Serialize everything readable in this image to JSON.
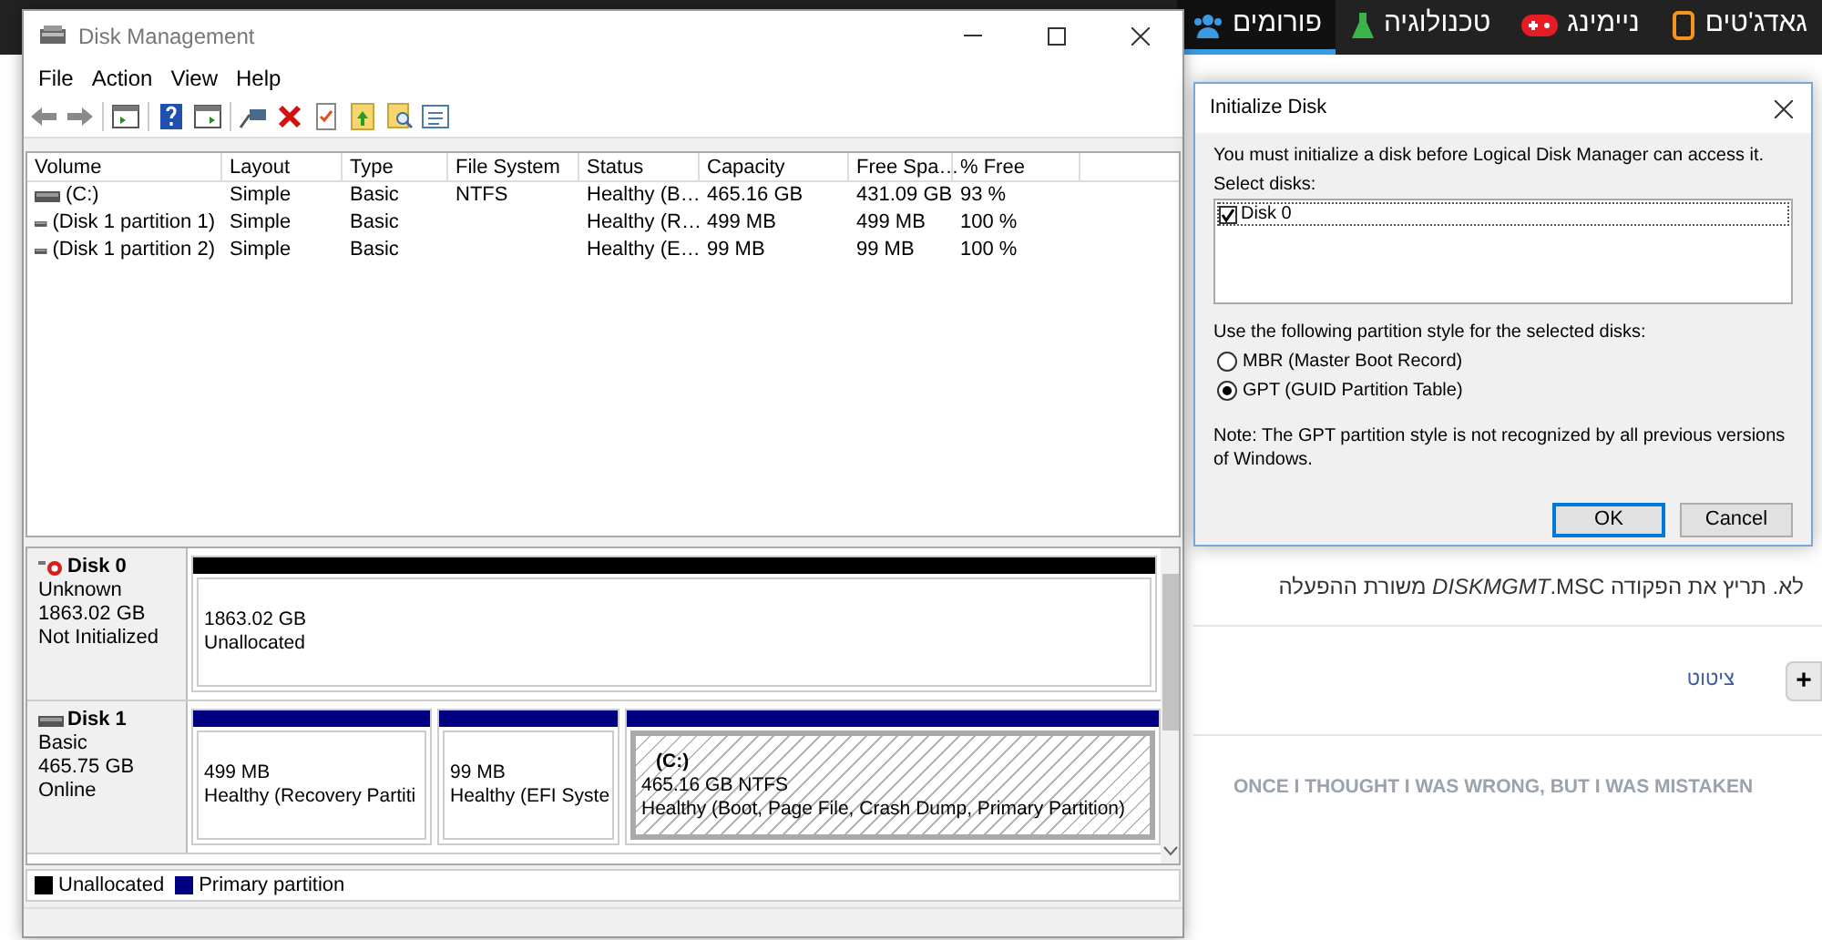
{
  "site_nav": {
    "tabs": [
      {
        "label": "גאדג'טים",
        "selected": false
      },
      {
        "label": "ניימינג",
        "selected": false
      },
      {
        "label": "טכנולוגיה",
        "selected": false
      },
      {
        "label": "פורומים",
        "selected": true
      }
    ]
  },
  "post": {
    "text": "לא.  תריץ את הפקודה *DISKMGMT*.MSC משורת ההפעלה",
    "quote_link": "ציטוט",
    "add_button": "+",
    "signature": "ONCE I THOUGHT I WAS WRONG, BUT I WAS MISTAKEN"
  },
  "disk_management": {
    "title": "Disk Management",
    "menu": [
      "File",
      "Action",
      "View",
      "Help"
    ],
    "columns": [
      "Volume",
      "Layout",
      "Type",
      "File System",
      "Status",
      "Capacity",
      "Free Spa…",
      "% Free"
    ],
    "rows": [
      {
        "volume": "(C:)",
        "layout": "Simple",
        "type": "Basic",
        "file_system": "NTFS",
        "status": "Healthy (B…",
        "capacity": "465.16 GB",
        "free_space": "431.09 GB",
        "percent_free": "93 %"
      },
      {
        "volume": "(Disk 1 partition 1)",
        "layout": "Simple",
        "type": "Basic",
        "file_system": "",
        "status": "Healthy (R…",
        "capacity": "499 MB",
        "free_space": "499 MB",
        "percent_free": "100 %"
      },
      {
        "volume": "(Disk 1 partition 2)",
        "layout": "Simple",
        "type": "Basic",
        "file_system": "",
        "status": "Healthy (E…",
        "capacity": "99 MB",
        "free_space": "99 MB",
        "percent_free": "100 %"
      }
    ],
    "disks": [
      {
        "name": "Disk 0",
        "kind": "error",
        "info": [
          "Unknown",
          "1863.02 GB",
          "Not Initialized"
        ],
        "partitions": [
          {
            "kind": "unallocated",
            "selected": false,
            "lines": [
              "1863.02 GB",
              "Unallocated"
            ]
          }
        ]
      },
      {
        "name": "Disk 1",
        "kind": "online",
        "info": [
          "Basic",
          "465.75 GB",
          "Online"
        ],
        "partitions": [
          {
            "kind": "primary",
            "selected": false,
            "lines": [
              "499 MB",
              "Healthy (Recovery Partiti"
            ]
          },
          {
            "kind": "primary",
            "selected": false,
            "lines": [
              "99 MB",
              "Healthy (EFI Syste"
            ]
          },
          {
            "kind": "primary",
            "selected": true,
            "label": "(C:)",
            "lines": [
              "465.16 GB NTFS",
              "Healthy (Boot, Page File, Crash Dump, Primary Partition)"
            ]
          }
        ]
      }
    ],
    "legend": [
      {
        "label": "Unallocated",
        "color": "#000000"
      },
      {
        "label": "Primary partition",
        "color": "#000080"
      }
    ]
  },
  "dialog": {
    "title": "Initialize Disk",
    "message": "You must initialize a disk before Logical Disk Manager can access it.",
    "select_label": "Select disks:",
    "disks": [
      {
        "label": "Disk 0",
        "checked": true
      }
    ],
    "style_label": "Use the following partition style for the selected disks:",
    "styles": [
      {
        "label": "MBR (Master Boot Record)",
        "selected": false
      },
      {
        "label": "GPT (GUID Partition Table)",
        "selected": true
      }
    ],
    "note": "Note: The GPT partition style is not recognized by all previous versions of Windows.",
    "buttons": [
      {
        "label": "OK",
        "kind": "default"
      },
      {
        "label": "Cancel",
        "kind": "normal"
      }
    ]
  }
}
